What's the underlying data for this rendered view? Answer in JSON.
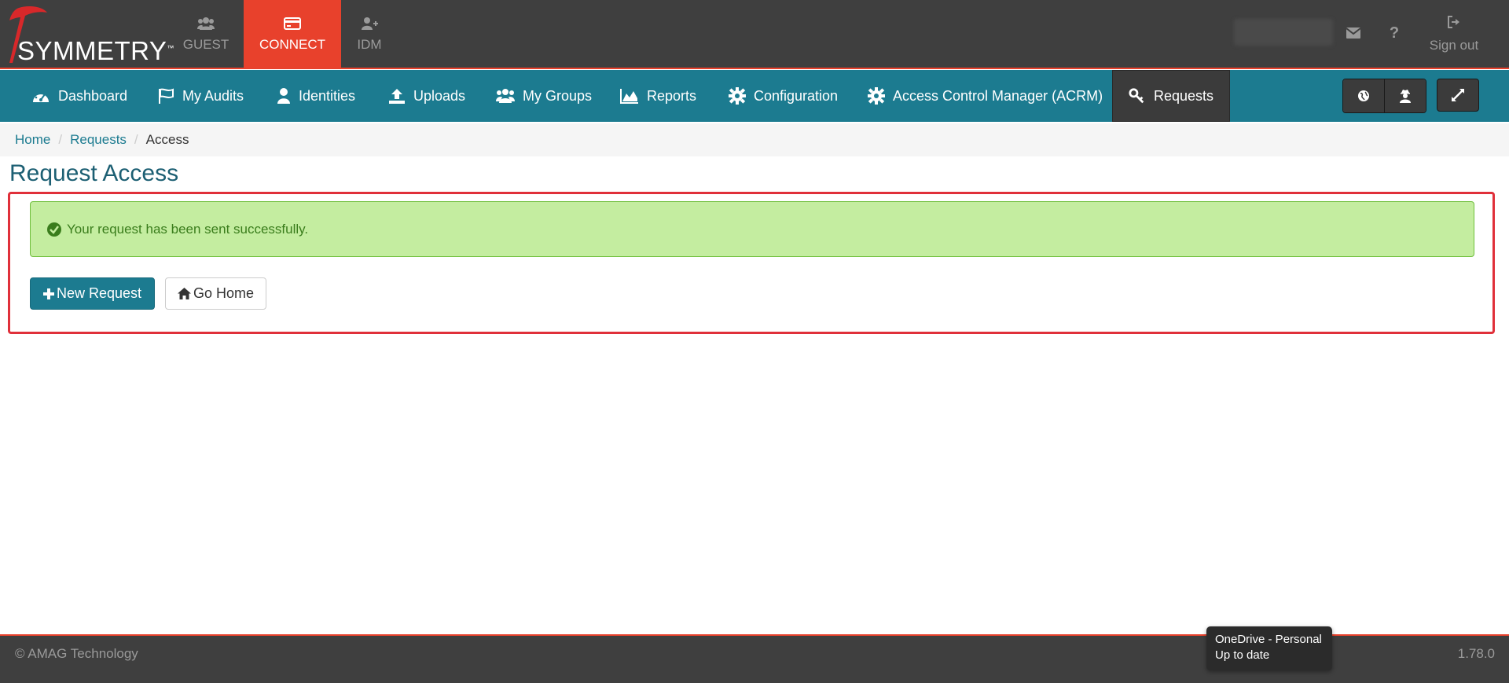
{
  "brand": {
    "name": "SYMMETRY",
    "tm": "™"
  },
  "app_tabs": [
    {
      "label": "GUEST",
      "icon": "users-icon"
    },
    {
      "label": "CONNECT",
      "icon": "card-icon"
    },
    {
      "label": "IDM",
      "icon": "user-plus-icon"
    }
  ],
  "top_right": {
    "mail_icon": "envelope-icon",
    "help_icon": "question-icon",
    "signout_label": "Sign out"
  },
  "nav": {
    "items": [
      {
        "label": "Dashboard",
        "icon": "dashboard-icon"
      },
      {
        "label": "My Audits",
        "icon": "flag-icon"
      },
      {
        "label": "Identities",
        "icon": "user-icon"
      },
      {
        "label": "Uploads",
        "icon": "upload-icon"
      },
      {
        "label": "My Groups",
        "icon": "users-icon"
      },
      {
        "label": "Reports",
        "icon": "area-chart-icon"
      },
      {
        "label": "Configuration",
        "icon": "gear-icon"
      },
      {
        "label": "Access Control Manager (ACRM)",
        "icon": "gear-icon"
      },
      {
        "label": "Requests",
        "icon": "key-icon"
      }
    ],
    "active": "Requests"
  },
  "breadcrumb": {
    "home": "Home",
    "requests": "Requests",
    "current": "Access"
  },
  "page_title": "Request Access",
  "alert": {
    "message": "Your request has been sent successfully."
  },
  "buttons": {
    "new_request": "New Request",
    "go_home": "Go Home"
  },
  "footer": {
    "copyright": "© AMAG Technology",
    "version": "1.78.0"
  },
  "tooltip": {
    "line1": "OneDrive - Personal",
    "line2": "Up to date"
  },
  "colors": {
    "accent": "#1c7b90",
    "brand_red": "#e8412c",
    "topbar": "#3f3f3f",
    "success_bg": "#c4eda0"
  }
}
